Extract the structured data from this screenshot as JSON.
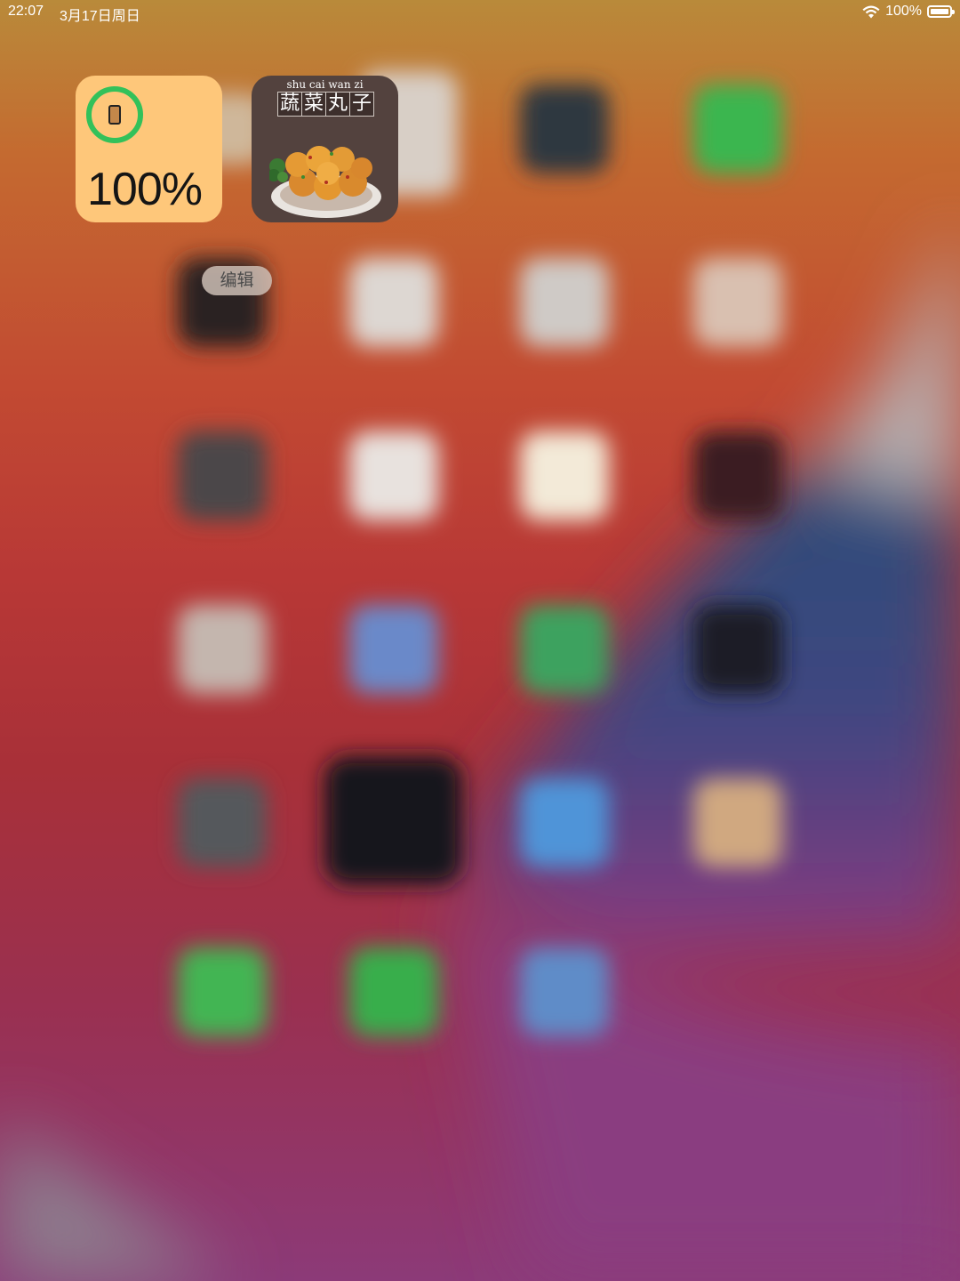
{
  "status_bar": {
    "time": "22:07",
    "date": "3月17日周日",
    "battery_text": "100%",
    "wifi_icon": "wifi-icon",
    "battery_icon": "battery-icon"
  },
  "widgets": {
    "battery": {
      "percent_text": "100%",
      "level": 1.0,
      "device_icon": "ipad-icon",
      "ring_color": "#33c15a",
      "background": "#fec77a"
    },
    "food": {
      "pinyin": "shu cai wan zi",
      "characters": [
        "蔬",
        "菜",
        "丸",
        "子"
      ],
      "image": "vegetable-balls-plate"
    }
  },
  "edit_pill": {
    "label": "编辑"
  }
}
